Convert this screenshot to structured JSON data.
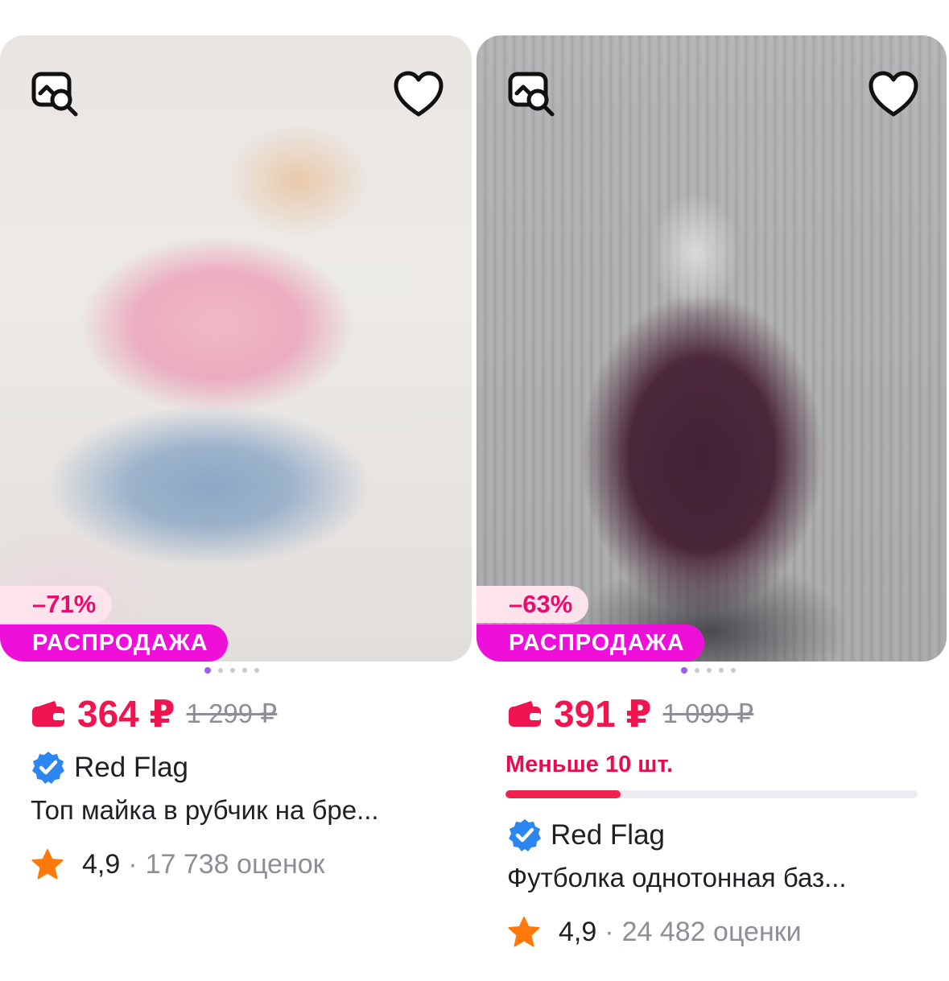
{
  "products": [
    {
      "discount": "–71%",
      "sale_label": "РАСПРОДАЖА",
      "price": "364 ₽",
      "old_price": "1 299 ₽",
      "brand": "Red Flag",
      "title": "Топ майка в рубчик на бре...",
      "rating": "4,9",
      "separator": "·",
      "reviews": "17 738 оценок",
      "photos_count": 5,
      "active_photo": 1
    },
    {
      "discount": "–63%",
      "sale_label": "РАСПРОДАЖА",
      "price": "391 ₽",
      "old_price": "1 099 ₽",
      "stock_text": "Меньше 10 шт.",
      "stock_level": 0.28,
      "brand": "Red Flag",
      "title": "Футболка однотонная баз...",
      "rating": "4,9",
      "separator": "·",
      "reviews": "24 482 оценки",
      "photos_count": 5,
      "active_photo": 1
    }
  ],
  "icons": {
    "search": "image-search-icon",
    "favorite": "heart-icon",
    "wallet": "wallet-icon",
    "verified": "verified-badge-icon",
    "star": "star-icon"
  },
  "colors": {
    "price": "#f0144f",
    "sale_badge": "#ee10d9",
    "discount_badge_bg": "#fde3ec",
    "discount_text": "#ea0b6c",
    "star": "#ff7a0a",
    "verified": "#2b86f0",
    "stock_bar": "#f0214e"
  }
}
